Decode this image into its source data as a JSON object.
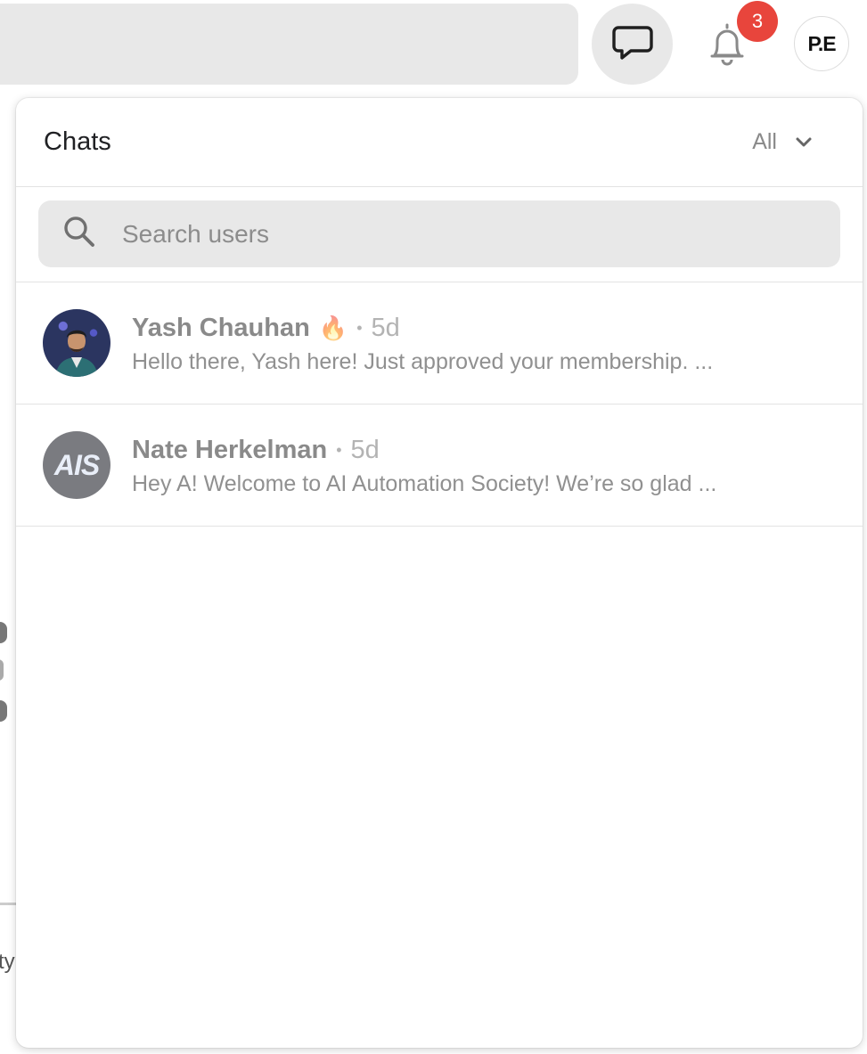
{
  "topbar": {
    "notification_count": "3",
    "user_initials": "P.E"
  },
  "background": {
    "partial_text": "ty"
  },
  "chats_panel": {
    "title": "Chats",
    "filter_label": "All",
    "search": {
      "placeholder": "Search users",
      "value": ""
    },
    "conversations": [
      {
        "name": "Yash Chauhan",
        "emoji": "🔥",
        "separator": "•",
        "time": "5d",
        "preview": "Hello there, Yash here! Just approved your membership. ...",
        "avatar": "photo"
      },
      {
        "name": "Nate Herkelman",
        "separator": "•",
        "time": "5d",
        "preview": "Hey A! Welcome to AI Automation Society! We’re so glad ...",
        "avatar": "AIS"
      }
    ]
  },
  "colors": {
    "badge": "#e8453c",
    "field_bg": "#e8e8e8"
  },
  "icons": [
    "chat-bubble-icon",
    "bell-icon",
    "search-icon",
    "chevron-down-icon"
  ]
}
